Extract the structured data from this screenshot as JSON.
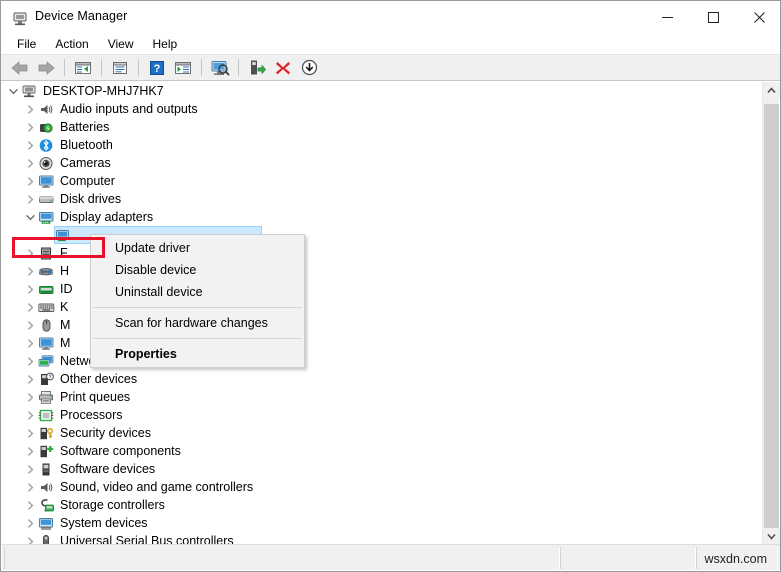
{
  "window": {
    "title": "Device Manager",
    "icon": "device-manager-icon",
    "controls": {
      "minimize": "—",
      "maximize": "□",
      "close": "✕"
    }
  },
  "menubar": {
    "items": [
      {
        "label": "File",
        "name": "menu-file"
      },
      {
        "label": "Action",
        "name": "menu-action"
      },
      {
        "label": "View",
        "name": "menu-view"
      },
      {
        "label": "Help",
        "name": "menu-help"
      }
    ]
  },
  "toolbar": {
    "buttons": [
      {
        "name": "back-icon",
        "type": "arrow-left"
      },
      {
        "name": "forward-icon",
        "type": "arrow-right"
      },
      {
        "name": "separator",
        "type": "sep"
      },
      {
        "name": "show-hide-console-tree-icon",
        "type": "tree-pane"
      },
      {
        "name": "separator",
        "type": "sep"
      },
      {
        "name": "properties-icon",
        "type": "properties"
      },
      {
        "name": "separator",
        "type": "sep"
      },
      {
        "name": "help-icon",
        "type": "help"
      },
      {
        "name": "show-hide-action-pane-icon",
        "type": "action-pane"
      },
      {
        "name": "separator",
        "type": "sep"
      },
      {
        "name": "scan-for-hardware-changes-icon",
        "type": "scan"
      },
      {
        "name": "separator",
        "type": "sep"
      },
      {
        "name": "update-driver-icon",
        "type": "update-driver"
      },
      {
        "name": "uninstall-device-icon",
        "type": "uninstall"
      },
      {
        "name": "disable-device-icon",
        "type": "disable"
      }
    ]
  },
  "tree": {
    "root": {
      "label": "DESKTOP-MHJ7HK7",
      "icon": "computer-root-icon",
      "expanded": true,
      "indent": 0
    },
    "nodes": [
      {
        "label": "Audio inputs and outputs",
        "icon": "speaker-icon",
        "expanded": false,
        "hidden_by_menu": false
      },
      {
        "label": "Batteries",
        "icon": "battery-icon",
        "expanded": false,
        "hidden_by_menu": false
      },
      {
        "label": "Bluetooth",
        "icon": "bluetooth-icon",
        "expanded": false,
        "hidden_by_menu": false
      },
      {
        "label": "Cameras",
        "icon": "camera-icon",
        "expanded": false,
        "hidden_by_menu": false
      },
      {
        "label": "Computer",
        "icon": "monitor-icon",
        "expanded": false,
        "hidden_by_menu": false
      },
      {
        "label": "Disk drives",
        "icon": "disk-drive-icon",
        "expanded": false,
        "hidden_by_menu": false
      },
      {
        "label": "Display adapters",
        "icon": "display-adapter-icon",
        "expanded": true,
        "hidden_by_menu": false
      },
      {
        "label": "F",
        "icon": "firmware-icon",
        "expanded": false,
        "hidden_by_menu": true
      },
      {
        "label": "H",
        "icon": "human-interface-icon",
        "expanded": false,
        "hidden_by_menu": true
      },
      {
        "label": "ID",
        "icon": "ide-controller-icon",
        "expanded": false,
        "hidden_by_menu": true
      },
      {
        "label": "K",
        "icon": "keyboard-icon",
        "expanded": false,
        "hidden_by_menu": true
      },
      {
        "label": "M",
        "icon": "mouse-icon",
        "expanded": false,
        "hidden_by_menu": true
      },
      {
        "label": "M",
        "icon": "monitor-icon",
        "expanded": false,
        "hidden_by_menu": true
      },
      {
        "label": "Network adapters",
        "icon": "network-adapter-icon",
        "expanded": false,
        "hidden_by_menu": false
      },
      {
        "label": "Other devices",
        "icon": "other-device-icon",
        "expanded": false,
        "hidden_by_menu": false
      },
      {
        "label": "Print queues",
        "icon": "printer-icon",
        "expanded": false,
        "hidden_by_menu": false
      },
      {
        "label": "Processors",
        "icon": "processor-icon",
        "expanded": false,
        "hidden_by_menu": false
      },
      {
        "label": "Security devices",
        "icon": "security-device-icon",
        "expanded": false,
        "hidden_by_menu": false
      },
      {
        "label": "Software components",
        "icon": "software-component-icon",
        "expanded": false,
        "hidden_by_menu": false
      },
      {
        "label": "Software devices",
        "icon": "software-device-icon",
        "expanded": false,
        "hidden_by_menu": false
      },
      {
        "label": "Sound, video and game controllers",
        "icon": "speaker-icon",
        "expanded": false,
        "hidden_by_menu": false
      },
      {
        "label": "Storage controllers",
        "icon": "storage-controller-icon",
        "expanded": false,
        "hidden_by_menu": false
      },
      {
        "label": "System devices",
        "icon": "system-device-icon",
        "expanded": false,
        "hidden_by_menu": false
      },
      {
        "label": "Universal Serial Bus controllers",
        "icon": "usb-controller-icon",
        "expanded": false,
        "hidden_by_menu": false
      }
    ],
    "selected_child": {
      "label": "",
      "icon": "display-adapter-device-icon",
      "selected": true
    }
  },
  "context_menu": {
    "items": [
      {
        "label": "Update driver",
        "bold": false,
        "highlighted": true,
        "name": "context-menu-update-driver"
      },
      {
        "label": "Disable device",
        "bold": false,
        "highlighted": false,
        "name": "context-menu-disable-device"
      },
      {
        "label": "Uninstall device",
        "bold": false,
        "highlighted": false,
        "name": "context-menu-uninstall-device"
      },
      {
        "label": "Scan for hardware changes",
        "bold": false,
        "highlighted": false,
        "name": "context-menu-scan-for-hardware-changes"
      },
      {
        "label": "Properties",
        "bold": true,
        "highlighted": false,
        "name": "context-menu-properties"
      }
    ]
  },
  "statusbar": {
    "left_text": "",
    "watermark": "wsxdn.com"
  },
  "colors": {
    "highlight_box": "#e8122a",
    "selection": "#cce8ff",
    "toolbar_bg": "#f0f0f0",
    "menu_bg": "#f2f2f2"
  },
  "scrollbar": {
    "up_arrow": "∧",
    "down_arrow": "∨"
  }
}
